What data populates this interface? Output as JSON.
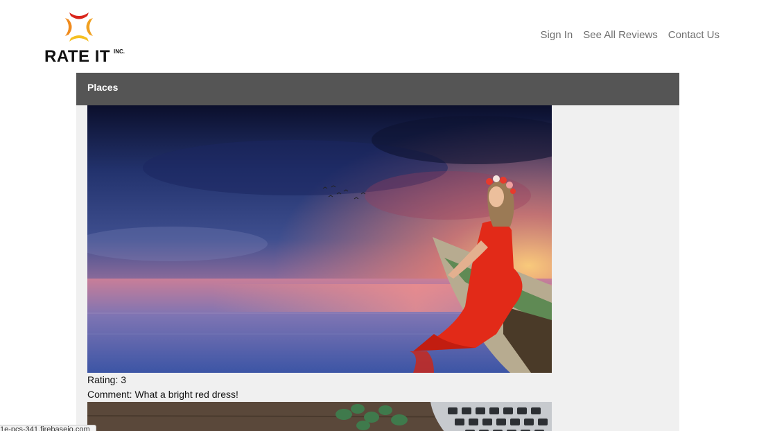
{
  "logo": {
    "name": "RATE IT",
    "suffix": "INC."
  },
  "nav": {
    "items": [
      "Sign In",
      "See All Reviews",
      "Contact Us"
    ]
  },
  "panel": {
    "title": "Places"
  },
  "reviews": [
    {
      "rating_label": "Rating:",
      "rating": "3",
      "comment_label": "Comment:",
      "comment": "What a bright red dress!"
    }
  ],
  "status_bar": {
    "text": "1e-pcs-341.firebaseio.com"
  },
  "colors": {
    "panel_header_bg": "#555555",
    "panel_bg": "#f0f0f0",
    "nav_text": "#6f6f6f",
    "dress_red": "#e22a18"
  }
}
